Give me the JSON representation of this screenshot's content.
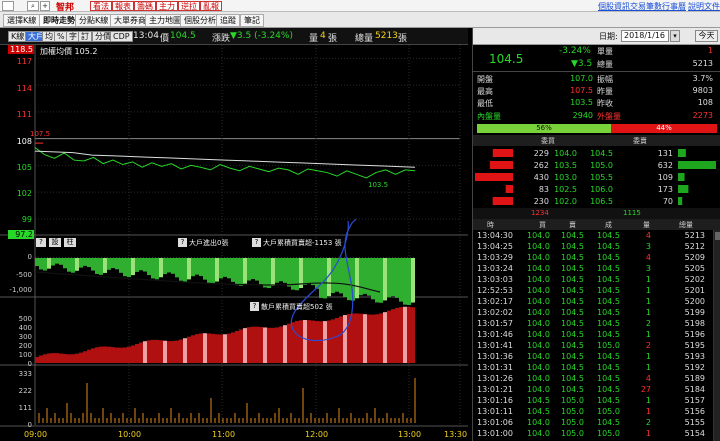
{
  "topbar": {
    "symbol": "智邦",
    "buttons": [
      "看法",
      "報表",
      "籌碼",
      "主力",
      "逆拉",
      "亂報"
    ],
    "links": [
      "個股資訊",
      "交易筆數",
      "行事曆",
      "說明文件"
    ]
  },
  "tabs": [
    "選擇K線",
    "即時走勢",
    "分點K線",
    "大單券商",
    "主力地圖",
    "個股分析",
    "追蹤",
    "筆記"
  ],
  "toolbar": {
    "buttons": [
      "K線",
      "大戶",
      "均",
      "%",
      "字",
      "訂",
      "分價",
      "CDP"
    ],
    "time": "13:04",
    "price_label": "價",
    "price": "104.5",
    "change_label": "漲跌",
    "change": "▼3.5 (-3.24%)",
    "vol_label": "量",
    "vol": "4",
    "vol_unit": "張",
    "total_label": "總量",
    "total": "5213",
    "total_unit": "張"
  },
  "main_chart": {
    "avg_label": "加權均價 105.2",
    "y_labels": [
      "118.5",
      "117",
      "114",
      "111",
      "108",
      "105",
      "102",
      "99",
      "97.2"
    ],
    "ref_price": "107.5",
    "low_label": "103.5",
    "x_labels": [
      "09:00",
      "10:00",
      "11:00",
      "12:00",
      "13:00",
      "13:30"
    ]
  },
  "sub_panel1": {
    "buttons": [
      "?",
      "設",
      "柱"
    ],
    "label_a": "大戶進出0張",
    "label_b": "大戶累積買賣超-1153 張",
    "y_labels": [
      "0",
      "-500",
      "-1,000"
    ]
  },
  "sub_panel2": {
    "label": "散戶累積買賣超502 張",
    "y_labels": [
      "500",
      "400",
      "300",
      "200",
      "100",
      "0"
    ]
  },
  "sub_panel3": {
    "y_labels": [
      "333",
      "222",
      "111",
      "0"
    ]
  },
  "right_panel": {
    "date_label": "日期:",
    "date": "2018/1/16",
    "today_btn": "今天",
    "quote_price": "104.5",
    "pct": "-3.24%",
    "chg": "▼3.5",
    "single_label": "單量",
    "single": "1",
    "total_label": "總量",
    "total": "5213",
    "rows": [
      [
        "開盤",
        "107.0",
        "振幅",
        "3.7%"
      ],
      [
        "最高",
        "107.5",
        "昨量",
        "9803"
      ],
      [
        "最低",
        "103.5",
        "昨收",
        "108"
      ]
    ],
    "inner_label": "內盤量",
    "inner": "2940",
    "outer_label": "外盤量",
    "outer": "2273",
    "bar_left": "56%",
    "bar_right": "44%",
    "book_head": [
      "委買",
      "委賣"
    ],
    "book": [
      [
        "229",
        "104.0",
        "104.5",
        "131"
      ],
      [
        "262",
        "103.5",
        "105.0",
        "632"
      ],
      [
        "430",
        "103.0",
        "105.5",
        "109"
      ],
      [
        "83",
        "102.5",
        "106.0",
        "173"
      ],
      [
        "230",
        "102.0",
        "106.5",
        "70"
      ]
    ],
    "book_totals": [
      "1234",
      "1115"
    ],
    "tick_head": [
      "時",
      "買",
      "賣",
      "成",
      "量",
      "總量"
    ],
    "ticks": [
      [
        "13:04:30",
        "104.0",
        "104.5",
        "104.5",
        "4",
        "5213"
      ],
      [
        "13:04:25",
        "104.0",
        "104.5",
        "104.5",
        "3",
        "5212"
      ],
      [
        "13:03:29",
        "104.0",
        "104.5",
        "104.5",
        "4",
        "5209"
      ],
      [
        "13:03:24",
        "104.0",
        "104.5",
        "104.5",
        "3",
        "5205"
      ],
      [
        "13:03:03",
        "104.0",
        "104.5",
        "104.5",
        "1",
        "5202"
      ],
      [
        "12:52:53",
        "104.0",
        "104.5",
        "104.5",
        "1",
        "5201"
      ],
      [
        "13:02:17",
        "104.0",
        "104.5",
        "104.5",
        "1",
        "5200"
      ],
      [
        "13:02:02",
        "104.0",
        "104.5",
        "104.5",
        "1",
        "5199"
      ],
      [
        "13:01:57",
        "104.0",
        "104.5",
        "104.5",
        "2",
        "5198"
      ],
      [
        "13:01:46",
        "104.0",
        "104.5",
        "104.5",
        "1",
        "5196"
      ],
      [
        "13:01:41",
        "104.0",
        "104.5",
        "105.0",
        "2",
        "5195"
      ],
      [
        "13:01:36",
        "104.0",
        "104.5",
        "104.5",
        "1",
        "5193"
      ],
      [
        "13:01:31",
        "104.0",
        "104.5",
        "104.5",
        "1",
        "5192"
      ],
      [
        "13:01:26",
        "104.0",
        "104.5",
        "104.5",
        "4",
        "5189"
      ],
      [
        "13:01:21",
        "104.0",
        "104.5",
        "104.5",
        "27",
        "5184"
      ],
      [
        "13:01:16",
        "104.5",
        "105.0",
        "104.5",
        "1",
        "5157"
      ],
      [
        "13:01:11",
        "104.5",
        "105.0",
        "105.0",
        "1",
        "5156"
      ],
      [
        "13:01:06",
        "104.0",
        "105.0",
        "104.5",
        "2",
        "5155"
      ],
      [
        "13:01:00",
        "104.0",
        "105.0",
        "105.0",
        "1",
        "5154"
      ]
    ]
  },
  "colors": {
    "up": "#ff3030",
    "down": "#28d828",
    "accent": "#3b6fd8"
  }
}
